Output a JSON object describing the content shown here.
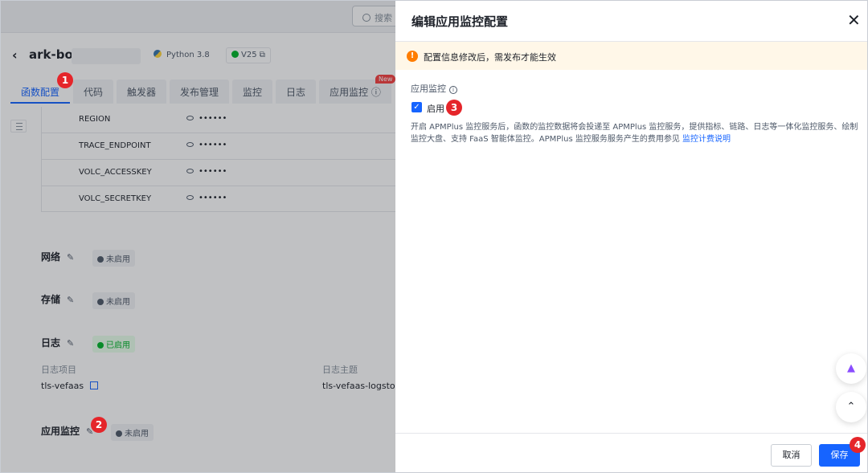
{
  "topbar": {
    "search_placeholder": "搜索"
  },
  "header": {
    "back_icon": "chevron-left-icon",
    "function_name": "ark-bot-",
    "runtime": "Python 3.8",
    "version": "V25"
  },
  "tabs": [
    {
      "label": "函数配置",
      "active": true
    },
    {
      "label": "代码"
    },
    {
      "label": "触发器"
    },
    {
      "label": "发布管理"
    },
    {
      "label": "监控"
    },
    {
      "label": "日志"
    },
    {
      "label": "应用监控"
    }
  ],
  "new_badge": "New",
  "env_vars": [
    {
      "key": "REGION",
      "value": "••••••"
    },
    {
      "key": "TRACE_ENDPOINT",
      "value": "••••••"
    },
    {
      "key": "VOLC_ACCESSKEY",
      "value": "••••••"
    },
    {
      "key": "VOLC_SECRETKEY",
      "value": "••••••"
    }
  ],
  "sections": {
    "network": {
      "title": "网络",
      "status": "未启用"
    },
    "storage": {
      "title": "存储",
      "status": "未启用"
    },
    "log": {
      "title": "日志",
      "status": "已启用",
      "project_label": "日志项目",
      "project_value": "tls-vefaas",
      "topic_label": "日志主题",
      "topic_value": "tls-vefaas-logstore"
    },
    "apm": {
      "title": "应用监控",
      "status": "未启用"
    }
  },
  "drawer": {
    "title": "编辑应用监控配置",
    "close_icon": "close-icon",
    "alert": "配置信息修改后，需发布才能生效",
    "field_label": "应用监控",
    "checkbox_label": "启用",
    "checkbox_checked": true,
    "description": "开启 APMPlus 监控服务后，函数的监控数据将会投递至 APMPlus 监控服务，提供指标、链路、日志等一体化监控服务、绘制监控大盘、支持 FaaS 智能体监控。APMPlus 监控服务服务产生的费用参见",
    "description_link": "监控计费说明",
    "cancel_label": "取消",
    "save_label": "保存"
  },
  "markers": [
    "1",
    "2",
    "3",
    "4"
  ],
  "colors": {
    "primary": "#1664ff",
    "marker": "#e5252a",
    "success": "#00b42a",
    "warning": "#ff7d00"
  }
}
